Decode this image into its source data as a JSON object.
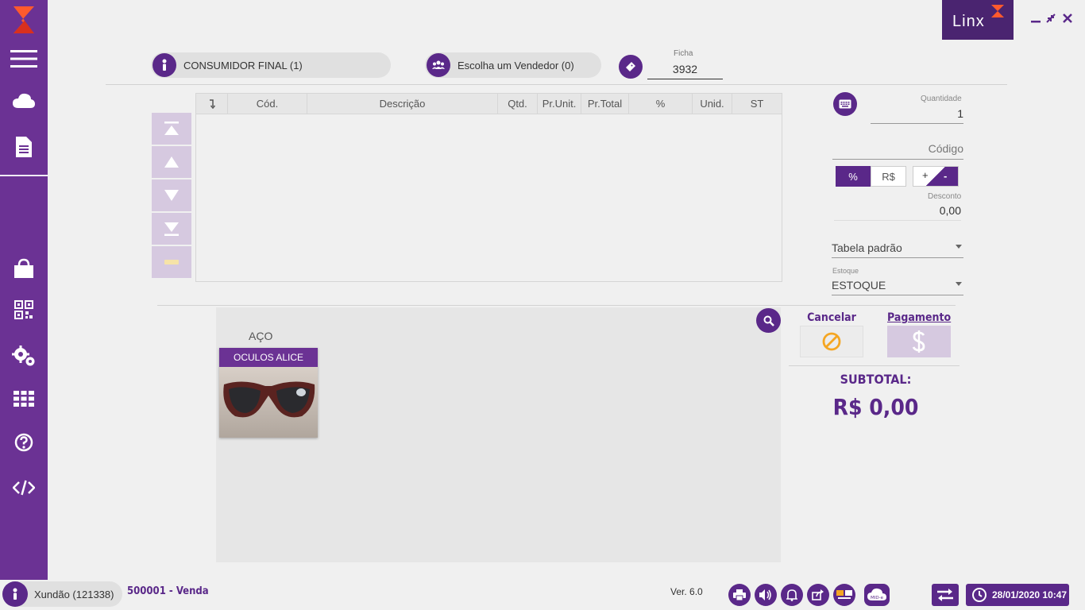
{
  "header": {
    "customer_label": "CONSUMIDOR FINAL (1)",
    "seller_label": "Escolha um Vendedor (0)",
    "ficha_label": "Ficha",
    "ficha_value": "3932",
    "logo_text": "Linx"
  },
  "table": {
    "columns": [
      "",
      "Cód.",
      "Descrição",
      "Qtd.",
      "Pr.Unit.",
      "Pr.Total",
      "%",
      "Unid.",
      "ST"
    ]
  },
  "right_panel": {
    "quantidade_label": "Quantidade",
    "quantidade_value": "1",
    "codigo_placeholder": "Código",
    "percent_label": "%",
    "currency_label": "R$",
    "plus_label": "+",
    "minus_label": "-",
    "desconto_label": "Desconto",
    "desconto_value": "0,00",
    "tabela_value": "Tabela padrão",
    "estoque_label": "Estoque",
    "estoque_value": "ESTOQUE"
  },
  "products": {
    "group_label": "AÇO",
    "items": [
      {
        "name": "OCULOS ALICE"
      }
    ]
  },
  "actions": {
    "cancel_label": "Cancelar",
    "payment_label": "Pagamento",
    "subtotal_label": "SUBTOTAL:",
    "subtotal_value": "R$ 0,00"
  },
  "footer": {
    "user_label": "Xundão (121338)",
    "terminal_label": "500001 - Venda",
    "version_label": "Ver. 6.0",
    "datetime_label": "28/01/2020 10:47"
  },
  "colors": {
    "brand": "#6b3294",
    "brand_dark": "#5a2889",
    "accent": "#f5a623"
  }
}
